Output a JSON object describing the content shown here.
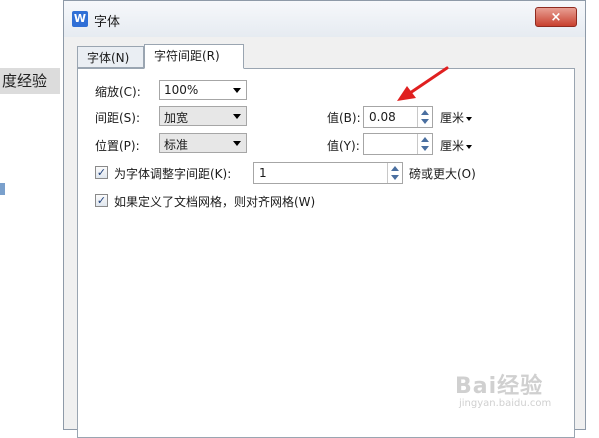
{
  "background": {
    "partial_text": "度经验"
  },
  "dialog": {
    "icon_letter": "W",
    "title": "字体",
    "close_label": "×",
    "tabs": [
      {
        "label": "字体(N)",
        "active": false
      },
      {
        "label": "字符间距(R)",
        "active": true
      }
    ],
    "scale": {
      "label": "缩放(C):",
      "value": "100%"
    },
    "spacing": {
      "label": "间距(S):",
      "value": "加宽",
      "by_label": "值(B):",
      "by_value": "0.08",
      "unit": "厘米"
    },
    "position": {
      "label": "位置(P):",
      "value": "标准",
      "by_label": "值(Y):",
      "by_value": "",
      "unit": "厘米"
    },
    "kerning": {
      "checked": true,
      "label": "为字体调整字间距(K):",
      "value": "1",
      "suffix": "磅或更大(O)"
    },
    "grid": {
      "checked": true,
      "label": "如果定义了文档网格，则对齐网格(W)"
    }
  },
  "watermark": {
    "text": "Bai经验",
    "url": "jingyan.baidu.com"
  },
  "colors": {
    "arrow": "#e02020",
    "close": "#c8402e"
  }
}
